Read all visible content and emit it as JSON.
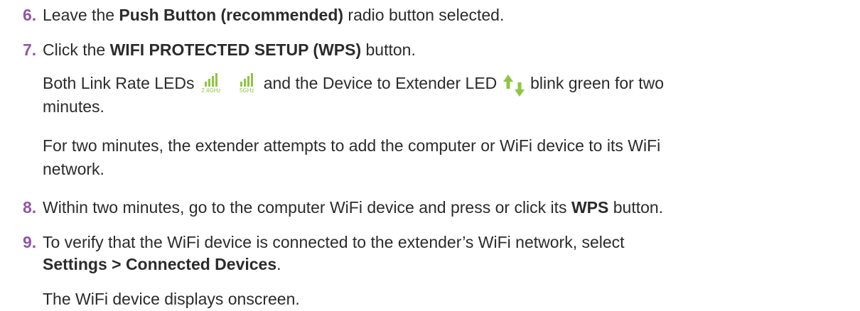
{
  "steps": [
    {
      "num": "6.",
      "pre": "Leave the ",
      "bold": "Push Button (recommended)",
      "post": " radio button selected."
    },
    {
      "num": "7.",
      "pre": "Click the ",
      "bold": "WIFI PROTECTED SETUP (WPS)",
      "post": " button."
    },
    {
      "num": "8.",
      "pre": "Within two minutes, go to the computer WiFi device and press or click its ",
      "bold": "WPS",
      "post": " button."
    },
    {
      "num": "9.",
      "line1": "To verify that the WiFi device is connected to the extender’s WiFi network, select",
      "bold": "Settings > Connected Devices",
      "post": "."
    }
  ],
  "led_para": {
    "pre": "Both Link Rate LEDs",
    "mid": "and the Device to Extender LED",
    "post": "blink green for two",
    "line2": "minutes."
  },
  "icons": [
    {
      "name": "link-rate-2.4ghz-led-icon",
      "caption": "2.4GHz",
      "color": "#8dc63f"
    },
    {
      "name": "link-rate-5ghz-led-icon",
      "caption": "5GHz",
      "color": "#8dc63f"
    },
    {
      "name": "device-to-extender-led-icon",
      "color": "#8dc63f"
    }
  ],
  "para_two_minutes": {
    "line1": "For two minutes, the extender attempts to add the computer or WiFi device to its WiFi",
    "line2": "network."
  },
  "final_para": "The WiFi device displays onscreen.",
  "colors": {
    "step_number": "#8f57a6",
    "text": "#2b2b2b",
    "led_green": "#8dc63f"
  }
}
